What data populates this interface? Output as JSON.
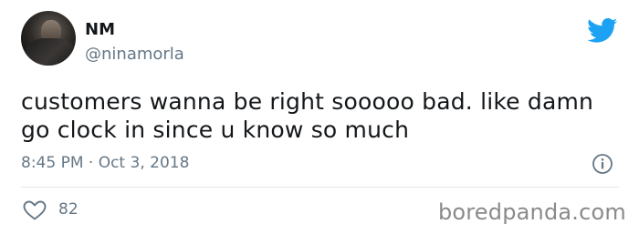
{
  "tweet": {
    "display_name": "NM",
    "handle": "@ninamorla",
    "text": "customers wanna be right sooooo bad. like damn go clock in since u know so much",
    "timestamp": "8:45 PM · Oct 3, 2018",
    "like_count": "82"
  },
  "icons": {
    "brand": "twitter-bird-icon",
    "info": "info-icon",
    "like": "heart-icon"
  },
  "colors": {
    "twitter_blue": "#1da1f2",
    "secondary_text": "#657786",
    "primary_text": "#14171a",
    "divider": "#e1e8ed"
  },
  "watermark": "boredpanda.com"
}
